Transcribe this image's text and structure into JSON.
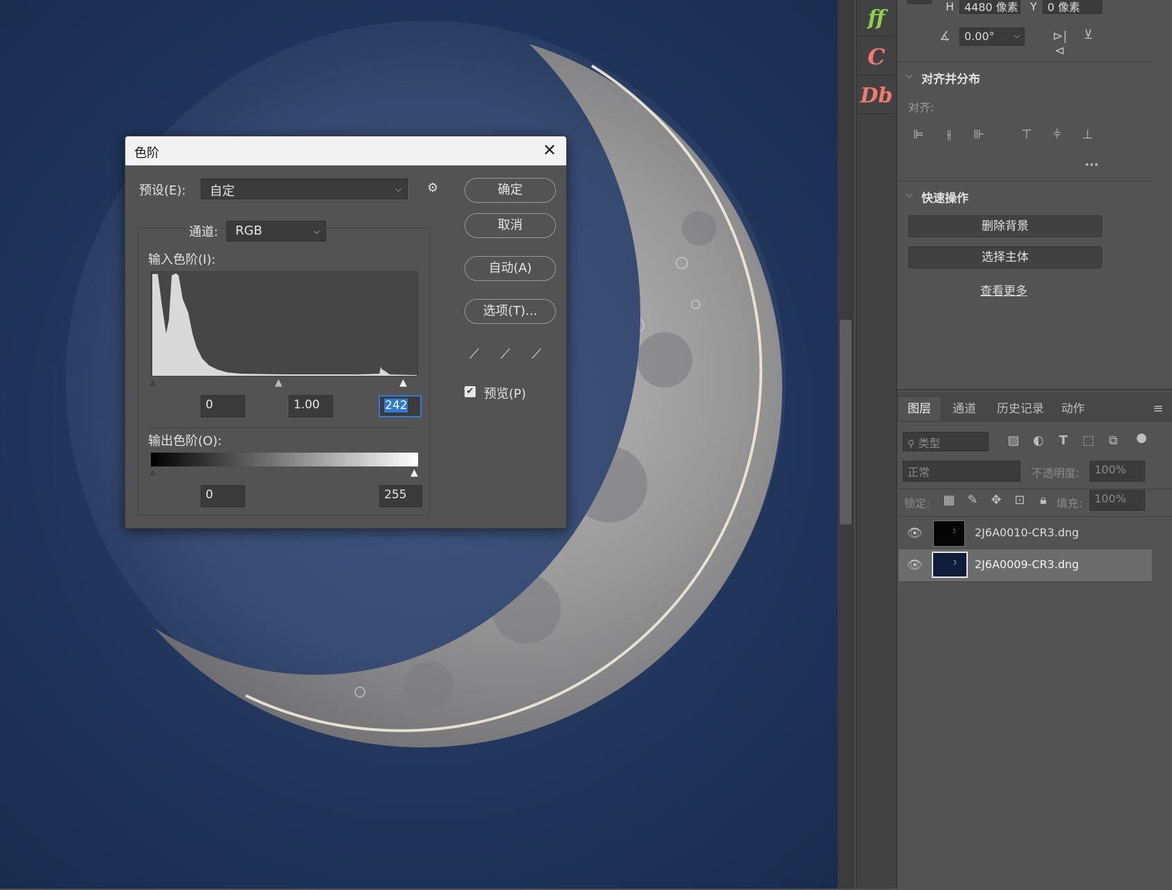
{
  "dialog": {
    "title": "色阶",
    "preset_label": "预设(E):",
    "preset_value": "自定",
    "channel_label": "通道:",
    "channel_value": "RGB",
    "input_levels_label": "输入色阶(I):",
    "input_black": "0",
    "input_gamma": "1.00",
    "input_white": "242",
    "output_levels_label": "输出色阶(O):",
    "output_black": "0",
    "output_white": "255",
    "ok_label": "确定",
    "cancel_label": "取消",
    "auto_label": "自动(A)",
    "options_label": "选项(T)...",
    "preview_label": "预览(P)",
    "preview_checked": true
  },
  "plugins": [
    {
      "label": "ff",
      "color": "#8fd14f"
    },
    {
      "label": "C",
      "color": "#f07a6b"
    },
    {
      "label": "Db",
      "color": "#f07a6b"
    }
  ],
  "properties": {
    "h_label": "H",
    "h_value": "4480 像素",
    "y_label": "Y",
    "y_value": "0 像素",
    "angle_value": "0.00°"
  },
  "align_section": {
    "title": "对齐并分布",
    "align_label": "对齐:"
  },
  "quick_actions": {
    "title": "快速操作",
    "remove_bg": "删除背景",
    "select_subject": "选择主体",
    "see_more": "查看更多"
  },
  "layers_panel": {
    "tabs": [
      "图层",
      "通道",
      "历史记录",
      "动作"
    ],
    "active_tab": "图层",
    "filter_placeholder": "类型",
    "blend_mode": "正常",
    "opacity_label": "不透明度:",
    "opacity_value": "100%",
    "lock_label": "锁定:",
    "fill_label": "填充:",
    "fill_value": "100%",
    "layers": [
      {
        "name": "2J6A0010-CR3.dng",
        "visible": true,
        "selected": false
      },
      {
        "name": "2J6A0009-CR3.dng",
        "visible": true,
        "selected": true
      }
    ]
  }
}
